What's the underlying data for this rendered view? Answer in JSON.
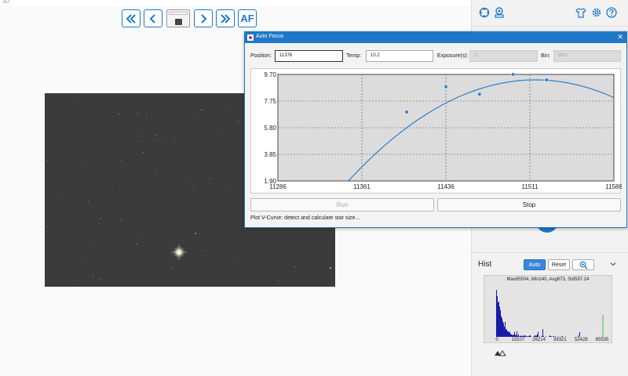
{
  "window": {
    "title": "3D"
  },
  "toolbar": {
    "first_icon": "double-chevron-left-icon",
    "prev_icon": "chevron-left-icon",
    "camera_icon": "camera-icon",
    "next_icon": "chevron-right-icon",
    "last_icon": "double-chevron-right-icon",
    "af_label": "AF"
  },
  "dialog": {
    "title": "Auto Focus",
    "close_glyph": "✕",
    "position_label": "Position:",
    "position_value": "11376",
    "temp_label": "Temp:",
    "temp_value": "10.2",
    "exposure_label": "Exposure(s):",
    "exposure_value": "3",
    "bin_label": "Bin:",
    "bin_value": "Bin1",
    "run_label": "Run",
    "stop_label": "Stop",
    "status": "Plot V-Curve: detect and calculate star size..."
  },
  "chart_data": {
    "type": "scatter",
    "title": "",
    "xlabel": "",
    "ylabel": "",
    "xlim": [
      11286,
      11586
    ],
    "ylim": [
      1.9,
      9.7
    ],
    "xticks": [
      "11286",
      "11361",
      "11436",
      "11511",
      "11586"
    ],
    "yticks": [
      "1.90",
      "3.85",
      "5.80",
      "7.75",
      "9.70"
    ],
    "grid": true,
    "points": [
      {
        "x": 11401,
        "y": 6.95
      },
      {
        "x": 11436,
        "y": 8.8
      },
      {
        "x": 11466,
        "y": 8.25
      },
      {
        "x": 11496,
        "y": 9.7
      },
      {
        "x": 11526,
        "y": 9.3
      }
    ],
    "fit_curve": {
      "vertex_x": 11516,
      "vertex_y": 9.3,
      "a": -0.000265
    }
  },
  "hist": {
    "label": "Hist",
    "auto_label": "Auto",
    "reset_label": "Reset",
    "zoom_icon": "zoom-in-icon",
    "stats": "Max65504, Min240, Avg873, Std597.24",
    "xticks": [
      "0",
      "13107",
      "26214",
      "39321",
      "52428",
      "65535"
    ]
  },
  "right_panel": {
    "icons": [
      "target-icon",
      "guider-icon",
      "shirt-icon",
      "gear-icon",
      "help-icon"
    ]
  },
  "colors": {
    "accent": "#1e78c8",
    "image_bg": "#3b3b3b",
    "hist_bar": "#1a1aa8"
  }
}
